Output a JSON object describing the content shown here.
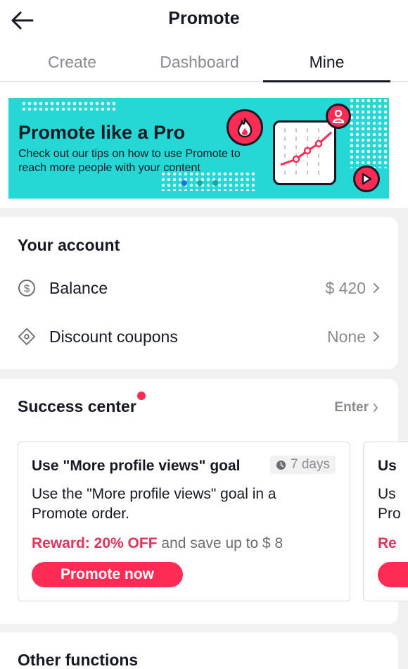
{
  "header": {
    "title": "Promote",
    "tabs": [
      {
        "label": "Create",
        "active": false
      },
      {
        "label": "Dashboard",
        "active": false
      },
      {
        "label": "Mine",
        "active": true
      }
    ]
  },
  "banner": {
    "title": "Promote like a Pro",
    "subtitle": "Check out our tips on how to use Promote to reach more people with your content",
    "page_count": 3,
    "active_page": 1,
    "colors": {
      "background": "#25d8d5",
      "accent": "#fe2c55"
    }
  },
  "account": {
    "title": "Your account",
    "rows": [
      {
        "icon": "dollar-icon",
        "label": "Balance",
        "value": "$ 420"
      },
      {
        "icon": "coupon-icon",
        "label": "Discount coupons",
        "value": "None"
      }
    ]
  },
  "success_center": {
    "title": "Success center",
    "enter_label": "Enter",
    "tasks": [
      {
        "title": "Use \"More profile views\" goal",
        "duration": "7 days",
        "description": "Use the \"More profile views\" goal in a\nPromote order.",
        "reward_highlight": "Reward: 20% OFF",
        "reward_rest": "and save up to $ 8",
        "button_label": "Promote now"
      },
      {
        "title": "Us",
        "description": "Us\nPro",
        "reward_highlight": "Re"
      }
    ]
  },
  "other_functions": {
    "title": "Other functions"
  }
}
